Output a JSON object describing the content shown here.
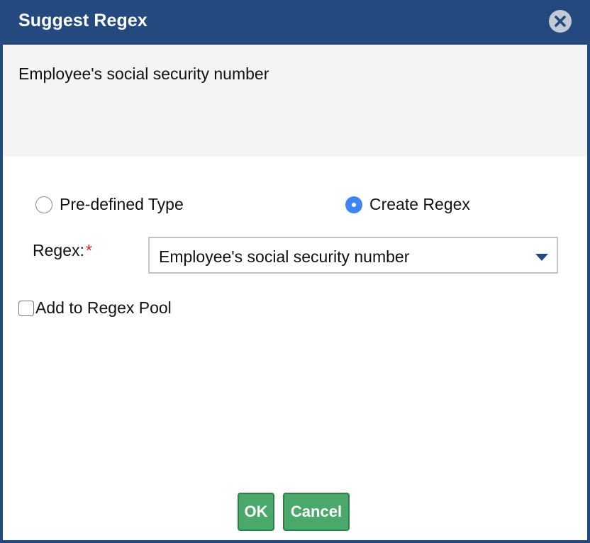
{
  "dialog": {
    "title": "Suggest Regex",
    "close_icon": "close-circle-icon"
  },
  "description": "Employee's social security number",
  "type_options": [
    {
      "label": "Pre-defined Type",
      "selected": false
    },
    {
      "label": "Create Regex",
      "selected": true
    }
  ],
  "regex_field": {
    "label": "Regex:",
    "required_marker": "*",
    "selected_value": "Employee's social security number",
    "arrow_icon": "caret-down-icon"
  },
  "pool_checkbox": {
    "label": "Add to Regex Pool",
    "checked": false
  },
  "buttons": {
    "ok_label": "OK",
    "cancel_label": "Cancel"
  },
  "colors": {
    "titlebar": "#23497f",
    "radio_selected": "#3d86f2",
    "button_green": "#4aa86b",
    "required": "#e02020"
  }
}
